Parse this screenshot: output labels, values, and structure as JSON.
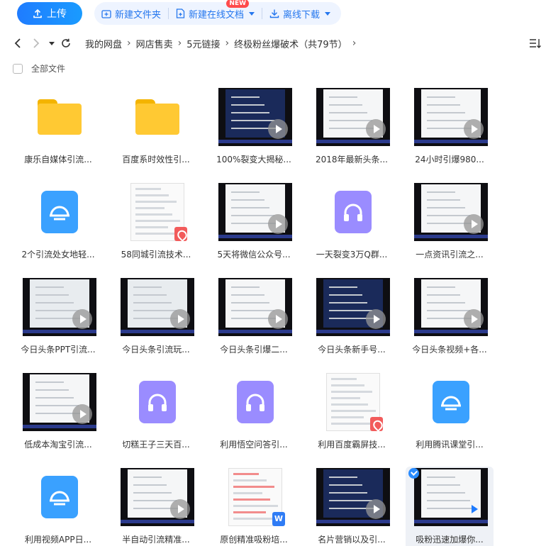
{
  "toolbar": {
    "upload_label": "上传",
    "new_folder_label": "新建文件夹",
    "new_online_doc_label": "新建在线文档",
    "new_badge": "NEW",
    "offline_download_label": "离线下载"
  },
  "breadcrumb": [
    "我的网盘",
    "网店售卖",
    "5元链接",
    "终极粉丝爆破术（共79节）"
  ],
  "all_files_label": "全部文件",
  "colors": {
    "accent": "#1f7cff",
    "folder": "#ffc933",
    "app_blue": "#3aa1ff",
    "app_purple": "#9a8cff",
    "pdf_red": "#f25b5b",
    "word_blue": "#2f7cf5"
  },
  "files": [
    {
      "name": "康乐自媒体引流...",
      "type": "folder"
    },
    {
      "name": "百度系时效性引...",
      "type": "folder"
    },
    {
      "name": "100%裂变大揭秘...",
      "type": "video",
      "screen": "dark"
    },
    {
      "name": "2018年最新头条...",
      "type": "video",
      "screen": "light"
    },
    {
      "name": "24小时引爆980...",
      "type": "video",
      "screen": "light"
    },
    {
      "name": "2个引流处女地轻...",
      "type": "app",
      "icon": "cloud-notes-icon",
      "color": "blue"
    },
    {
      "name": "58同城引流技术...",
      "type": "pdf"
    },
    {
      "name": "5天将微信公众号...",
      "type": "video",
      "screen": "light"
    },
    {
      "name": "一天裂变3万Q群...",
      "type": "app",
      "icon": "headphones-icon",
      "color": "purple"
    },
    {
      "name": "一点资讯引流之...",
      "type": "video",
      "screen": "light"
    },
    {
      "name": "今日头条PPT引流...",
      "type": "video",
      "screen": "mixed"
    },
    {
      "name": "今日头条引流玩...",
      "type": "video",
      "screen": "mixed"
    },
    {
      "name": "今日头条引爆二...",
      "type": "video",
      "screen": "light"
    },
    {
      "name": "今日头条新手号...",
      "type": "video",
      "screen": "dark"
    },
    {
      "name": "今日头条视频+各...",
      "type": "video",
      "screen": "light"
    },
    {
      "name": "低成本淘宝引流...",
      "type": "video",
      "screen": "light"
    },
    {
      "name": "切糕王子三天百...",
      "type": "app",
      "icon": "headphones-icon",
      "color": "purple"
    },
    {
      "name": "利用悟空问答引...",
      "type": "app",
      "icon": "headphones-icon",
      "color": "purple"
    },
    {
      "name": "利用百度霸屏技...",
      "type": "pdf"
    },
    {
      "name": "利用腾讯课堂引...",
      "type": "app",
      "icon": "cloud-notes-icon",
      "color": "blue"
    },
    {
      "name": "利用视频APP日...",
      "type": "app",
      "icon": "cloud-notes-icon",
      "color": "blue"
    },
    {
      "name": "半自动引流精准...",
      "type": "video",
      "screen": "light"
    },
    {
      "name": "原创精准吸粉培...",
      "type": "word"
    },
    {
      "name": "名片营销以及引...",
      "type": "video",
      "screen": "dark"
    },
    {
      "name": "吸粉迅速加爆你...",
      "type": "video",
      "screen": "light",
      "selected": true
    }
  ]
}
